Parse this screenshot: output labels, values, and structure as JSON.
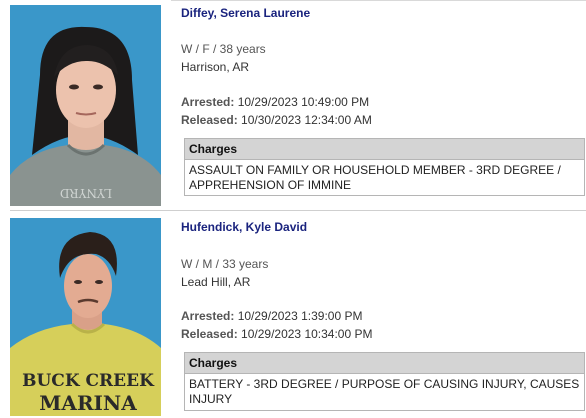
{
  "records": [
    {
      "name": "Diffey, Serena Laurene",
      "demographics": "W / F / 38 years",
      "location": "Harrison, AR",
      "arrested_label": "Arrested:",
      "arrested": "10/29/2023 10:49:00 PM",
      "released_label": "Released:",
      "released": "10/30/2023 12:34:00 AM",
      "charges_header": "Charges",
      "charges": "ASSAULT ON FAMILY OR HOUSEHOLD MEMBER - 3RD DEGREE / APPREHENSION OF IMMINE",
      "photo": {
        "icon": "mugshot-photo",
        "background": "#3a97c9",
        "shirt_text": "LYNYRD"
      }
    },
    {
      "name": "Hufendick, Kyle David",
      "demographics": "W / M / 33 years",
      "location": "Lead Hill, AR",
      "arrested_label": "Arrested:",
      "arrested": "10/29/2023 1:39:00 PM",
      "released_label": "Released:",
      "released": "10/29/2023 10:34:00 PM",
      "charges_header": "Charges",
      "charges": "BATTERY - 3RD DEGREE / PURPOSE OF CAUSING INJURY, CAUSES INJURY",
      "photo": {
        "icon": "mugshot-photo",
        "background": "#3a97c9",
        "shirt_text_1": "BUCK CREEK",
        "shirt_text_2": "MARINA"
      }
    }
  ],
  "colors": {
    "name": "#1a237e",
    "charges_header_bg": "#d4d4d4",
    "photo_bg": "#3a97c9"
  }
}
